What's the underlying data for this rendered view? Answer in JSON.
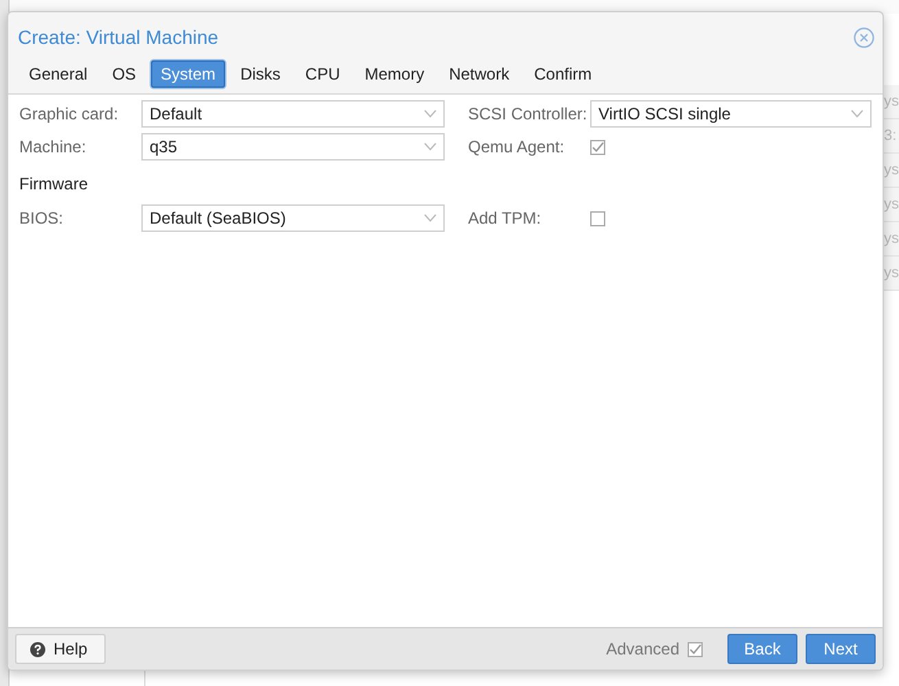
{
  "background": {
    "edge_fragments": [
      "ys",
      "3:",
      "ys",
      "ys",
      "ys",
      "ys"
    ]
  },
  "dialog": {
    "title": "Create: Virtual Machine",
    "tabs": [
      {
        "label": "General",
        "selected": false
      },
      {
        "label": "OS",
        "selected": false
      },
      {
        "label": "System",
        "selected": true
      },
      {
        "label": "Disks",
        "selected": false
      },
      {
        "label": "CPU",
        "selected": false
      },
      {
        "label": "Memory",
        "selected": false
      },
      {
        "label": "Network",
        "selected": false
      },
      {
        "label": "Confirm",
        "selected": false
      }
    ],
    "rows": [
      {
        "left": {
          "kind": "combo",
          "label": "Graphic card:",
          "value": "Default"
        },
        "right": {
          "kind": "combo",
          "label": "SCSI Controller:",
          "value": "VirtIO SCSI single"
        }
      },
      {
        "left": {
          "kind": "combo",
          "label": "Machine:",
          "value": "q35"
        },
        "right": {
          "kind": "checkbox",
          "label": "Qemu Agent:",
          "checked": true
        }
      },
      {
        "left": {
          "kind": "heading",
          "label": "Firmware"
        }
      },
      {
        "left": {
          "kind": "combo",
          "label": "BIOS:",
          "value": "Default (SeaBIOS)"
        },
        "right": {
          "kind": "checkbox",
          "label": "Add TPM:",
          "checked": false
        }
      }
    ],
    "footer": {
      "help": "Help",
      "advanced": {
        "label": "Advanced",
        "checked": true
      },
      "buttons": [
        "Back",
        "Next"
      ]
    }
  }
}
